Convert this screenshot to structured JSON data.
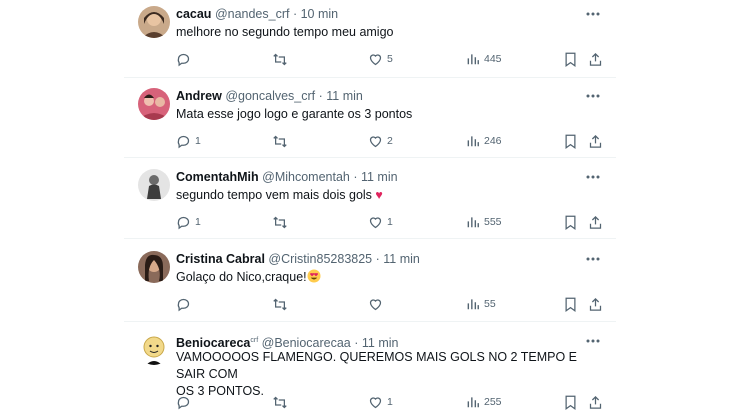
{
  "tweets": [
    {
      "name": "cacau",
      "name_sup": "",
      "handle": "@nandes_crf",
      "time": "· 10 min",
      "text": "melhore no segundo tempo meu amigo",
      "text_line2": "",
      "emoji": "",
      "replies": "",
      "likes": "5",
      "views": "445"
    },
    {
      "name": "Andrew",
      "name_sup": "",
      "handle": "@goncalves_crf",
      "time": "· 11 min",
      "text": "Mata esse jogo logo e garante os 3 pontos",
      "text_line2": "",
      "emoji": "",
      "replies": "1",
      "likes": "2",
      "views": "246"
    },
    {
      "name": "ComentahMih",
      "name_sup": "",
      "handle": "@Mihcomentah",
      "time": "· 11 min",
      "text": "segundo tempo vem mais dois gols ",
      "text_line2": "",
      "emoji": "♥",
      "replies": "1",
      "likes": "1",
      "views": "555"
    },
    {
      "name": "Cristina Cabral",
      "name_sup": "",
      "handle": "@Cristin85283825",
      "time": "· 11 min",
      "text": "Golaço do Nico,craque!",
      "text_line2": "",
      "emoji": "heart-eyes-emoji",
      "replies": "",
      "likes": "",
      "views": "55"
    },
    {
      "name": "Beniocareca",
      "name_sup": "crf",
      "handle": "@Beniocarecaa",
      "time": "· 11 min",
      "text": "VAMOOOOOS FLAMENGO. QUEREMOS MAIS GOLS NO 2 TEMPO E SAIR COM",
      "text_line2": "OS 3 PONTOS.",
      "emoji": "",
      "replies": "",
      "likes": "1",
      "views": "255"
    }
  ],
  "icons": {
    "reply": "reply-icon",
    "retweet": "retweet-icon",
    "like": "like-icon",
    "views": "views-icon",
    "bookmark": "bookmark-icon",
    "share": "share-icon",
    "more": "more-icon"
  },
  "colors": {
    "text": "#0f1419",
    "secondary": "#536471",
    "separator": "#eff3f4",
    "heart": "#e0245e"
  }
}
